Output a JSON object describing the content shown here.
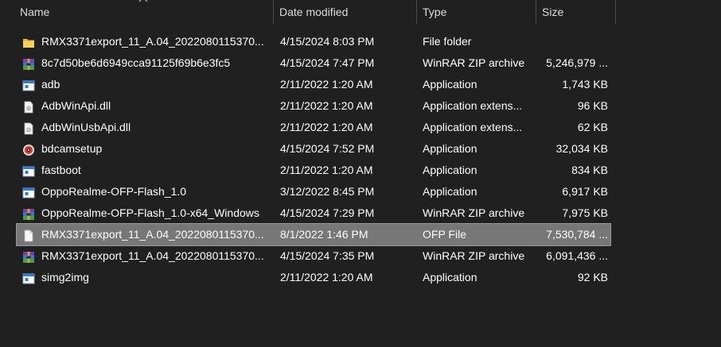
{
  "columns": {
    "name": "Name",
    "date": "Date modified",
    "type": "Type",
    "size": "Size"
  },
  "sort_icon": "chevron-up-icon",
  "selected_row_index": 9,
  "files": [
    {
      "name": "RMX3371export_11_A.04_2022080115370...",
      "date": "4/15/2024 8:03 PM",
      "type": "File folder",
      "size": "",
      "icon": "folder-icon"
    },
    {
      "name": "8c7d50be6d6949cca91125f69b6e3fc5",
      "date": "4/15/2024 7:47 PM",
      "type": "WinRAR ZIP archive",
      "size": "5,246,979 ...",
      "icon": "winrar-archive-icon"
    },
    {
      "name": "adb",
      "date": "2/11/2022 1:20 AM",
      "type": "Application",
      "size": "1,743 KB",
      "icon": "application-icon"
    },
    {
      "name": "AdbWinApi.dll",
      "date": "2/11/2022 1:20 AM",
      "type": "Application extens...",
      "size": "96 KB",
      "icon": "dll-file-icon"
    },
    {
      "name": "AdbWinUsbApi.dll",
      "date": "2/11/2022 1:20 AM",
      "type": "Application extens...",
      "size": "62 KB",
      "icon": "dll-file-icon"
    },
    {
      "name": "bdcamsetup",
      "date": "4/15/2024 7:52 PM",
      "type": "Application",
      "size": "32,034 KB",
      "icon": "bandicam-icon"
    },
    {
      "name": "fastboot",
      "date": "2/11/2022 1:20 AM",
      "type": "Application",
      "size": "834 KB",
      "icon": "application-icon"
    },
    {
      "name": "OppoRealme-OFP-Flash_1.0",
      "date": "3/12/2022 8:45 PM",
      "type": "Application",
      "size": "6,917 KB",
      "icon": "application-icon"
    },
    {
      "name": "OppoRealme-OFP-Flash_1.0-x64_Windows",
      "date": "4/15/2024 7:29 PM",
      "type": "WinRAR ZIP archive",
      "size": "7,975 KB",
      "icon": "winrar-archive-icon"
    },
    {
      "name": "RMX3371export_11_A.04_2022080115370...",
      "date": "8/1/2022 1:46 PM",
      "type": "OFP File",
      "size": "7,530,784 ...",
      "icon": "blank-file-icon"
    },
    {
      "name": "RMX3371export_11_A.04_2022080115370...",
      "date": "4/15/2024 7:35 PM",
      "type": "WinRAR ZIP archive",
      "size": "6,091,436 ...",
      "icon": "winrar-archive-icon"
    },
    {
      "name": "simg2img",
      "date": "2/11/2022 1:20 AM",
      "type": "Application",
      "size": "92 KB",
      "icon": "application-icon"
    }
  ]
}
